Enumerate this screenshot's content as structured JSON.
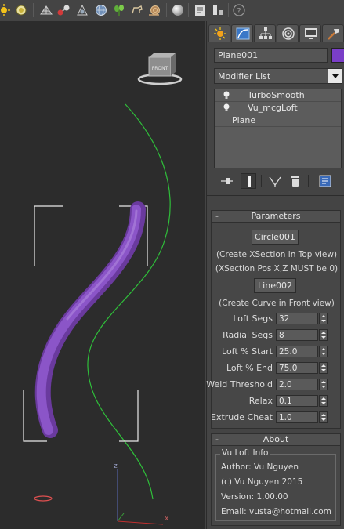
{
  "object": {
    "name": "Plane001",
    "color": "#7a3ec8"
  },
  "modifier_list": {
    "selected": "Modifier List"
  },
  "stack": {
    "items": [
      {
        "label": "TurboSmooth"
      },
      {
        "label": "Vu_mcgLoft"
      },
      {
        "label": "Plane"
      }
    ]
  },
  "viewport": {
    "viewcube_label": "FRONT",
    "gizmo_axes": {
      "z": "z",
      "x": "x"
    }
  },
  "parameters": {
    "title": "Parameters",
    "collapse_symbol": "-",
    "xsection_button": "Circle001",
    "xsection_note": "(Create XSection in Top view)",
    "xsection_note2": "(XSection Pos X,Z MUST be 0)",
    "curve_button": "Line002",
    "curve_note": "(Create Curve in Front view)",
    "fields": [
      {
        "label": "Loft Segs",
        "value": "32"
      },
      {
        "label": "Radial Segs",
        "value": "8"
      },
      {
        "label": "Loft % Start",
        "value": "25.0"
      },
      {
        "label": "Loft % End",
        "value": "75.0"
      },
      {
        "label": "Weld Threshold",
        "value": "2.0"
      },
      {
        "label": "Relax",
        "value": "0.1"
      },
      {
        "label": "Extrude Cheat",
        "value": "1.0"
      }
    ]
  },
  "about": {
    "title": "About",
    "collapse_symbol": "-",
    "group_title": "Vu Loft Info",
    "lines": [
      "Author: Vu Nguyen",
      "(c) Vu Nguyen 2015",
      "Version: 1.00.00",
      "Email: vusta@hotmail.com"
    ]
  },
  "icons": {
    "toolbar": [
      "sun-icon",
      "sphere-light-icon",
      "grid-render-icon",
      "molecule-icon",
      "scatter-icon",
      "globe-icon",
      "plant-icon",
      "animal-icon",
      "snail-icon",
      "sphere-icon",
      "list-icon",
      "help-icon"
    ],
    "panel_tabs": [
      "create-icon",
      "modify-icon",
      "hierarchy-icon",
      "motion-icon",
      "display-icon",
      "utilities-icon"
    ],
    "stack_tools": [
      "pin-stack-icon",
      "show-end-result-icon",
      "make-unique-icon",
      "remove-modifier-icon",
      "configure-sets-icon"
    ]
  }
}
